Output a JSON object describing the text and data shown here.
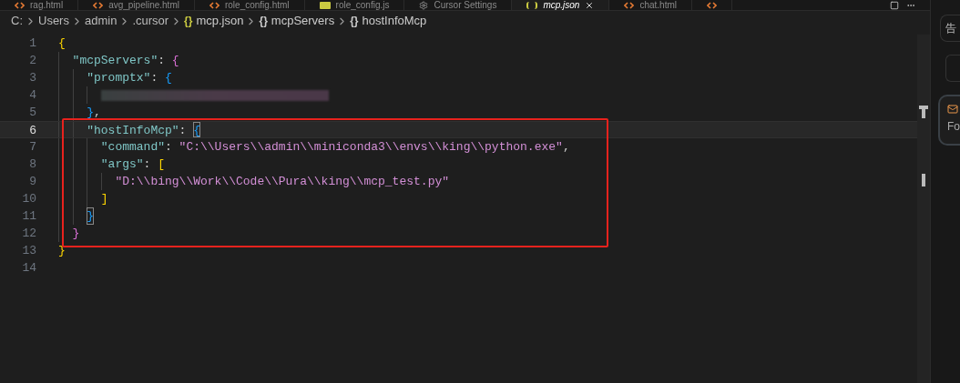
{
  "tabs": [
    {
      "label": "rag.html",
      "kind": "html",
      "selected": false
    },
    {
      "label": "avg_pipeline.html",
      "kind": "html",
      "selected": false
    },
    {
      "label": "role_config.html",
      "kind": "html",
      "selected": false
    },
    {
      "label": "role_config.js",
      "kind": "js",
      "selected": false
    },
    {
      "label": "Cursor Settings",
      "kind": "settings",
      "selected": false
    },
    {
      "label": "mcp.json",
      "kind": "json",
      "selected": true
    },
    {
      "label": "chat.html",
      "kind": "html",
      "selected": false
    },
    {
      "kind": "html",
      "selected": false
    }
  ],
  "breadcrumb": [
    {
      "kind": "folder",
      "text": "C:"
    },
    {
      "kind": "folder",
      "text": "Users"
    },
    {
      "kind": "folder",
      "text": "admin"
    },
    {
      "kind": "folder",
      "text": ".cursor"
    },
    {
      "kind": "file",
      "icon": "{}",
      "text": "mcp.json"
    },
    {
      "kind": "object",
      "icon": "{}",
      "text": "mcpServers"
    },
    {
      "kind": "object",
      "icon": "{}",
      "text": "hostInfoMcp"
    }
  ],
  "lines": [
    {
      "number": "1",
      "current": false,
      "tokens": [
        {
          "kind": "bracket",
          "text": "{",
          "color": "#ffd700",
          "matched": false
        }
      ]
    },
    {
      "number": "2",
      "current": false,
      "tokens": [
        {
          "kind": "key",
          "text": "\"mcpServers\""
        },
        {
          "kind": "punct",
          "text": ": "
        },
        {
          "kind": "bracket",
          "text": "{",
          "color": "#da70d6",
          "matched": false
        }
      ]
    },
    {
      "number": "3",
      "current": false,
      "tokens": [
        {
          "kind": "key",
          "text": "\"promptx\""
        },
        {
          "kind": "punct",
          "text": ": "
        },
        {
          "kind": "bracket",
          "text": "{",
          "color": "#179fff",
          "matched": false
        }
      ]
    },
    {
      "number": "4",
      "current": false,
      "tokens": [
        {
          "kind": "redacted"
        }
      ]
    },
    {
      "number": "5",
      "current": false,
      "tokens": [
        {
          "kind": "bracket",
          "text": "}",
          "color": "#179fff",
          "matched": false
        },
        {
          "kind": "punct",
          "text": ","
        }
      ]
    },
    {
      "number": "6",
      "current": true,
      "tokens": [
        {
          "kind": "key",
          "text": "\"hostInfoMcp\""
        },
        {
          "kind": "punct",
          "text": ": "
        },
        {
          "kind": "bracket",
          "text": "{",
          "color": "#179fff",
          "matched": true
        }
      ]
    },
    {
      "number": "7",
      "current": false,
      "tokens": [
        {
          "kind": "key",
          "text": "\"command\""
        },
        {
          "kind": "punct",
          "text": ": "
        },
        {
          "kind": "string",
          "text": "\"C:\\\\Users\\\\admin\\\\miniconda3\\\\envs\\\\king\\\\python.exe\""
        },
        {
          "kind": "punct",
          "text": ","
        }
      ]
    },
    {
      "number": "8",
      "current": false,
      "tokens": [
        {
          "kind": "key",
          "text": "\"args\""
        },
        {
          "kind": "punct",
          "text": ": "
        },
        {
          "kind": "bracket",
          "text": "[",
          "color": "#ffd700",
          "matched": false
        }
      ]
    },
    {
      "number": "9",
      "current": false,
      "tokens": [
        {
          "kind": "string",
          "text": "\"D:\\\\bing\\\\Work\\\\Code\\\\Pura\\\\king\\\\mcp_test.py\""
        }
      ]
    },
    {
      "number": "10",
      "current": false,
      "tokens": [
        {
          "kind": "bracket",
          "text": "]",
          "color": "#ffd700",
          "matched": false
        }
      ]
    },
    {
      "number": "11",
      "current": false,
      "tokens": [
        {
          "kind": "bracket",
          "text": "}",
          "color": "#179fff",
          "matched": true
        }
      ]
    },
    {
      "number": "12",
      "current": false,
      "tokens": [
        {
          "kind": "bracket",
          "text": "}",
          "color": "#da70d6",
          "matched": false
        }
      ]
    },
    {
      "number": "13",
      "current": false,
      "tokens": [
        {
          "kind": "bracket",
          "text": "}",
          "color": "#ffd700",
          "matched": false
        }
      ]
    },
    {
      "number": "14",
      "current": false
    }
  ],
  "side_panel": [
    {
      "kind": "pill",
      "text": "告"
    },
    {
      "kind": "box"
    },
    {
      "kind": "card",
      "text": "Fo"
    }
  ]
}
